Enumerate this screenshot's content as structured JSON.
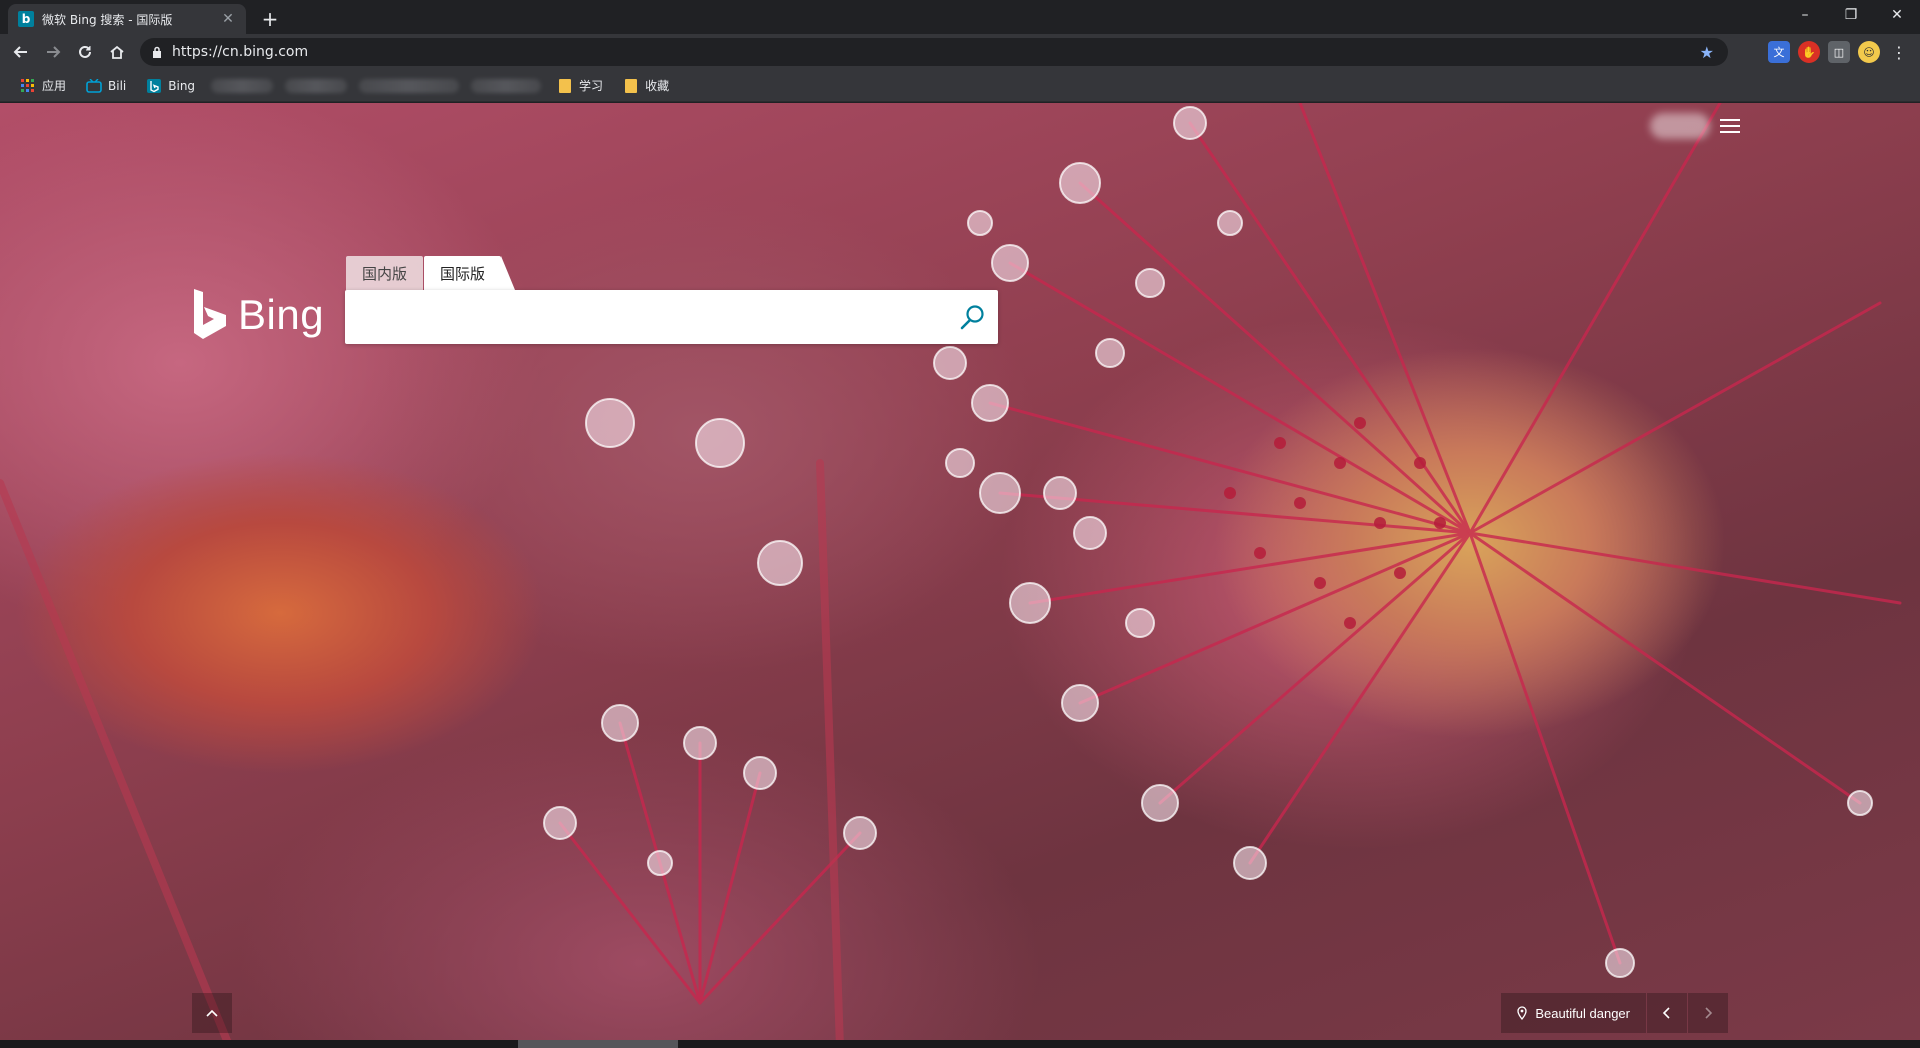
{
  "browser": {
    "tab": {
      "title": "微软 Bing 搜索 - 国际版",
      "favicon": "bing-favicon"
    },
    "window_controls": {
      "minimize": "–",
      "restore": "❐",
      "close": "✕"
    },
    "url": "https://cn.bing.com",
    "bookmarks": [
      {
        "label": "应用",
        "icon": "apps-grid-icon"
      },
      {
        "label": "Bili",
        "icon": "bilibili-icon"
      },
      {
        "label": "Bing",
        "icon": "bing-icon"
      },
      {
        "label": "学习",
        "icon": "folder-icon"
      },
      {
        "label": "收藏",
        "icon": "folder-icon"
      }
    ]
  },
  "page": {
    "logo_text": "Bing",
    "scope_tabs": [
      {
        "label": "国内版",
        "active": false
      },
      {
        "label": "国际版",
        "active": true
      }
    ],
    "search": {
      "value": "",
      "placeholder": ""
    },
    "caption": "Beautiful danger",
    "colors": {
      "accent": "#00809d",
      "folder": "#f3c14c"
    }
  }
}
